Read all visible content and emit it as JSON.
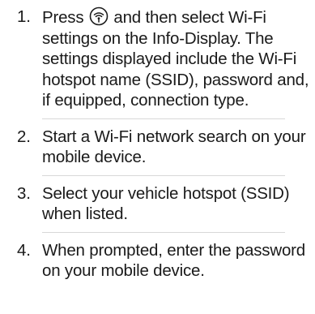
{
  "steps": [
    {
      "number": "1.",
      "text_before_icon": "Press",
      "icon": "wifi-hotspot-icon",
      "text_after_icon": "and then select Wi-Fi settings on the Info-Display. The settings displayed include the Wi-Fi hotspot name (SSID), password and, if equipped, connection type."
    },
    {
      "number": "2.",
      "text": "Start a Wi-Fi network search on your mobile device."
    },
    {
      "number": "3.",
      "text": "Select your vehicle hotspot (SSID) when listed."
    },
    {
      "number": "4.",
      "text": "When prompted, enter the password on your mobile device."
    }
  ]
}
